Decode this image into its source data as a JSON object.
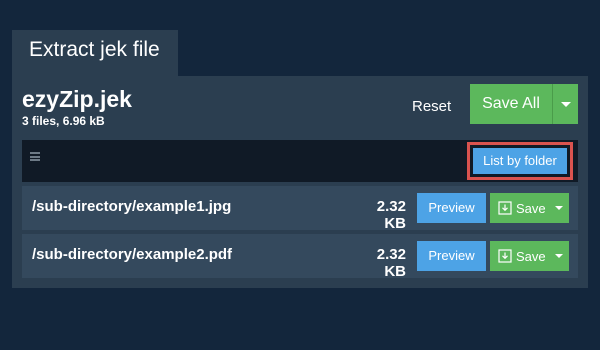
{
  "tab": {
    "label": "Extract jek file"
  },
  "archive": {
    "name": "ezyZip.jek",
    "meta": "3 files, 6.96 kB"
  },
  "actions": {
    "reset_label": "Reset",
    "save_all_label": "Save All"
  },
  "toolbar": {
    "menu_icon": "hamburger-icon",
    "list_by_folder_label": "List by folder"
  },
  "files": [
    {
      "path": "/sub-directory/example1.jpg",
      "size": "2.32 KB",
      "preview_label": "Preview",
      "save_label": "Save"
    },
    {
      "path": "/sub-directory/example2.pdf",
      "size": "2.32 KB",
      "preview_label": "Preview",
      "save_label": "Save"
    }
  ],
  "colors": {
    "background": "#13263c",
    "panel": "#2b3e50",
    "row": "#34495d",
    "toolbar": "#101a26",
    "primary": "#4da3e6",
    "success": "#5cb85c",
    "highlight": "#d9534f"
  }
}
